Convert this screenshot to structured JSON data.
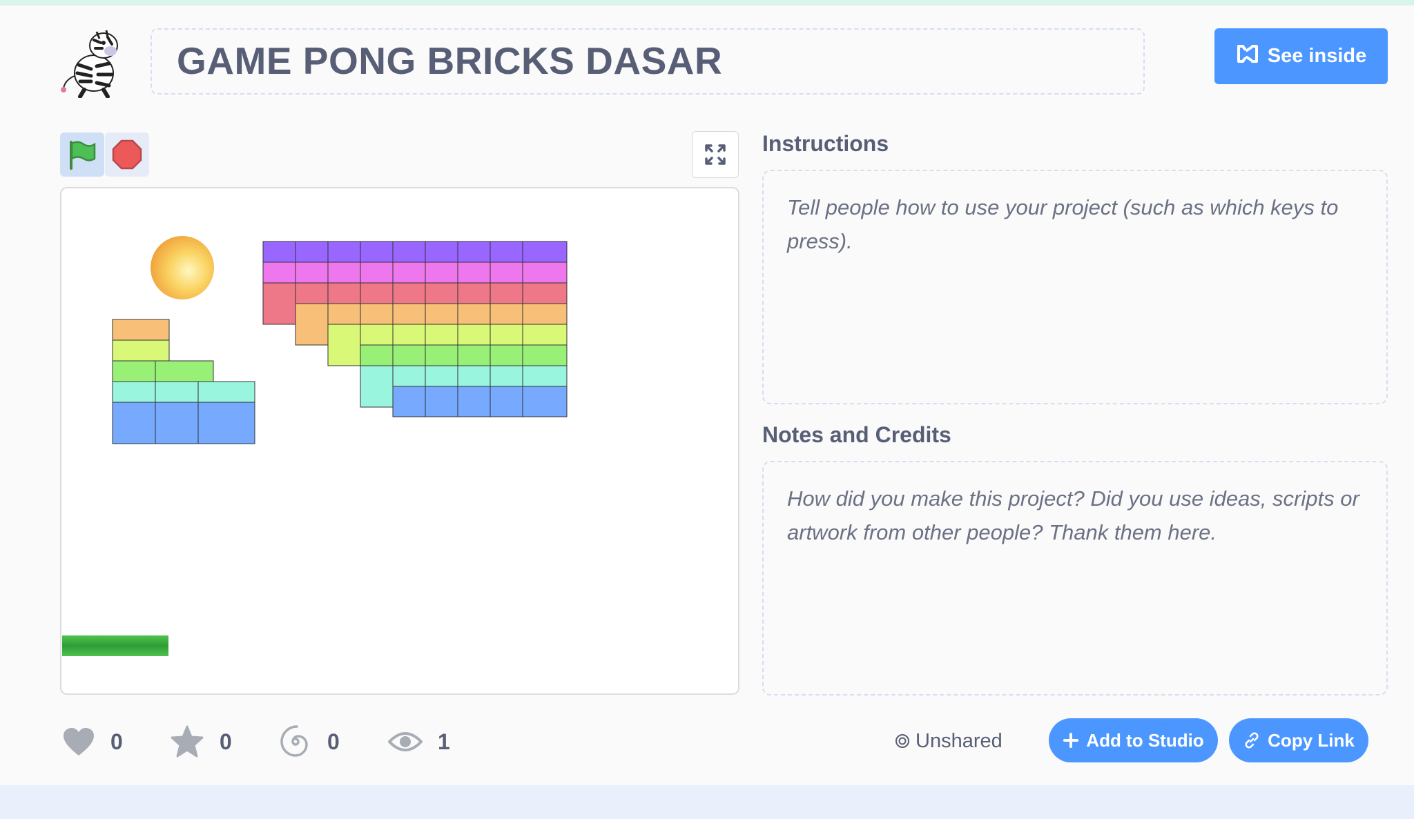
{
  "project": {
    "title": "GAME PONG BRICKS DASAR"
  },
  "header": {
    "see_inside_label": "See inside",
    "avatar_icon": "zebra-avatar-icon"
  },
  "player": {
    "green_flag_icon": "green-flag-icon",
    "stop_icon": "stop-sign-icon",
    "fullscreen_icon": "fullscreen-icon"
  },
  "instructions": {
    "label": "Instructions",
    "placeholder": "Tell people how to use your project (such as which keys to press)."
  },
  "notes": {
    "label": "Notes and Credits",
    "placeholder": "How did you make this project? Did you use ideas, scripts or artwork from other people? Thank them here."
  },
  "stats": {
    "loves": "0",
    "favorites": "0",
    "remixes": "0",
    "views": "1"
  },
  "share": {
    "status": "Unshared",
    "add_to_studio": "Add to Studio",
    "copy_link": "Copy Link"
  },
  "colors": {
    "accent": "#4c97ff",
    "brick_rows": [
      "#9966ff",
      "#ee77ee",
      "#ee7788",
      "#f7bf77",
      "#d9f877",
      "#99f077",
      "#99f5dd",
      "#77aaff"
    ]
  }
}
